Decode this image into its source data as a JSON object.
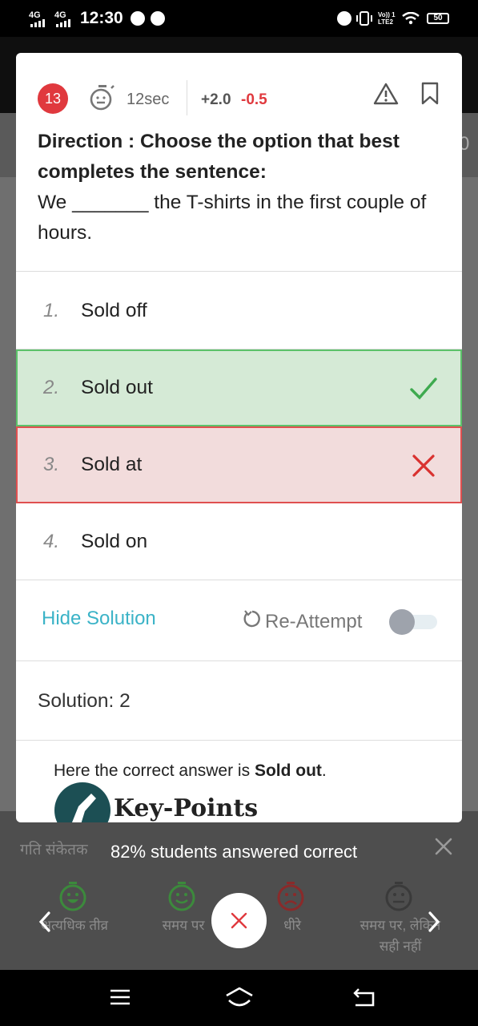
{
  "status_bar": {
    "network_1": "4G",
    "network_2": "4G",
    "time": "12:30",
    "volte_line1": "Vo)) 1",
    "volte_line2": "LTE2",
    "battery": "50"
  },
  "background": {
    "sub_number": "0"
  },
  "question_header": {
    "number": "13",
    "time": "12sec",
    "positive_marks": "+2.0",
    "negative_marks": "-0.5",
    "icons": [
      "stopwatch-icon",
      "warning-icon",
      "bookmark-icon"
    ]
  },
  "question": {
    "direction": "Direction : Choose the option that best completes the sentence:",
    "text": "We _______ the T-shirts in the first couple of hours."
  },
  "options": [
    {
      "num": "1.",
      "text": "Sold off",
      "state": "normal"
    },
    {
      "num": "2.",
      "text": "Sold out",
      "state": "correct"
    },
    {
      "num": "3.",
      "text": "Sold at",
      "state": "wrong"
    },
    {
      "num": "4.",
      "text": "Sold on",
      "state": "normal"
    }
  ],
  "controls": {
    "hide_solution": "Hide Solution",
    "reattempt": "Re-Attempt",
    "reattempt_enabled": false
  },
  "solution": {
    "title": "Solution: 2",
    "text_prefix": "Here the correct answer is ",
    "answer": "Sold out",
    "text_suffix": ".",
    "keypoints": "Key-Points"
  },
  "stats": {
    "caption": "गति संकेतक",
    "text": "82% students answered correct",
    "speed_labels": [
      "अत्यधिक तीव्र",
      "समय पर",
      "धीरे",
      "समय पर, लेकिन सही नहीं"
    ]
  },
  "colors": {
    "accent": "#3bb3c7",
    "correct_bg": "#d5ead6",
    "correct_border": "#5cc26a",
    "wrong_bg": "#f2dcdc",
    "wrong_border": "#e05050",
    "question_badge": "#e0393e"
  }
}
